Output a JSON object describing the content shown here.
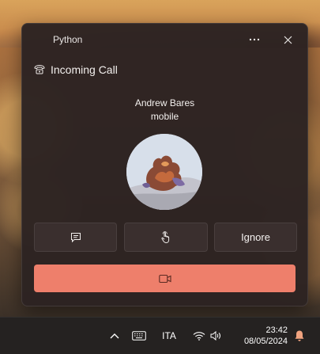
{
  "window": {
    "app_name": "Python",
    "more_icon": "more-horizontal-icon",
    "close_icon": "close-icon"
  },
  "notification": {
    "header_icon": "telephone-icon",
    "title": "Incoming Call",
    "caller_name": "Andrew Bares",
    "caller_type": "mobile",
    "avatar": "caller-avatar-photo"
  },
  "actions": {
    "message_icon": "message-icon",
    "tap_icon": "touch-hand-icon",
    "ignore_label": "Ignore",
    "video_icon": "video-camera-icon",
    "video_color": "#ee7f6b"
  },
  "taskbar": {
    "chevron_icon": "chevron-up-icon",
    "keyboard_icon": "keyboard-icon",
    "language": "ITA",
    "wifi_icon": "wifi-icon",
    "volume_icon": "volume-icon",
    "time": "23:42",
    "date": "08/05/2024",
    "bell_icon": "notification-bell-icon",
    "bell_color": "#f0a37f"
  }
}
